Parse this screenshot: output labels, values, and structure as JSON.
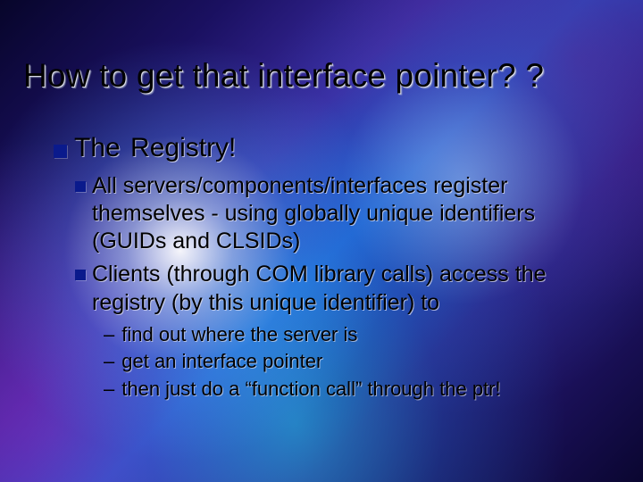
{
  "title": "How to get that interface pointer? ?",
  "lvl1": "The Registry!",
  "lvl2": [
    "All servers/components/interfaces register themselves - using globally unique identifiers (GUIDs and CLSIDs)",
    "Clients (through COM library calls) access the registry (by this unique identifier) to"
  ],
  "lvl3": [
    "find out where the server is",
    "get an interface pointer",
    "then just do a “function call” through the ptr!"
  ],
  "dash": "–"
}
